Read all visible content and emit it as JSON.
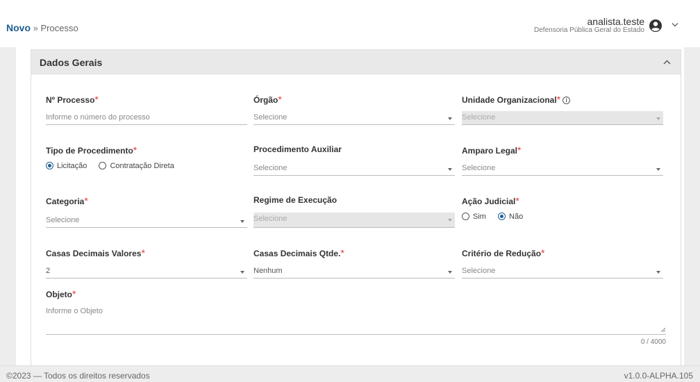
{
  "header": {
    "breadcrumb_home": "Novo",
    "breadcrumb_sep": "»",
    "breadcrumb_current": "Processo",
    "user_name": "analista.teste",
    "user_org": "Defensoria Pública Geral do Estado"
  },
  "section": {
    "title": "Dados Gerais"
  },
  "fields": {
    "numero_processo": {
      "label": "Nº Processo",
      "placeholder": "Informe o número do processo"
    },
    "orgao": {
      "label": "Órgão",
      "value": "Selecione"
    },
    "unidade": {
      "label": "Unidade Organizacional",
      "value": "Selecione"
    },
    "tipo_procedimento": {
      "label": "Tipo de Procedimento",
      "options": [
        "Licitação",
        "Contratação Direta"
      ],
      "selected": "Licitação"
    },
    "procedimento_auxiliar": {
      "label": "Procedimento Auxiliar",
      "value": "Selecione"
    },
    "amparo_legal": {
      "label": "Amparo Legal",
      "value": "Selecione"
    },
    "categoria": {
      "label": "Categoria",
      "value": "Selecione"
    },
    "regime_execucao": {
      "label": "Regime de Execução",
      "value": "Selecione"
    },
    "acao_judicial": {
      "label": "Ação Judicial",
      "options": [
        "Sim",
        "Não"
      ],
      "selected": "Não"
    },
    "casas_valores": {
      "label": "Casas Decimais Valores",
      "value": "2"
    },
    "casas_qtde": {
      "label": "Casas Decimais Qtde.",
      "value": "Nenhum"
    },
    "criterio_reducao": {
      "label": "Critério de Redução",
      "value": "Selecione"
    },
    "objeto": {
      "label": "Objeto",
      "placeholder": "Informe o Objeto",
      "counter": "0 / 4000"
    }
  },
  "required_mark": "*",
  "footer": {
    "copyright": "©2023 — Todos os direitos reservados",
    "version": "v1.0.0-ALPHA.105"
  },
  "colors": {
    "brand": "#1f5d92",
    "required": "#e53935",
    "section_bg": "#e9e9e9"
  },
  "icons": {
    "avatar": "user-circle-icon",
    "user_menu": "chevron-down-icon",
    "collapse": "chevron-up-icon",
    "info": "info-icon"
  }
}
